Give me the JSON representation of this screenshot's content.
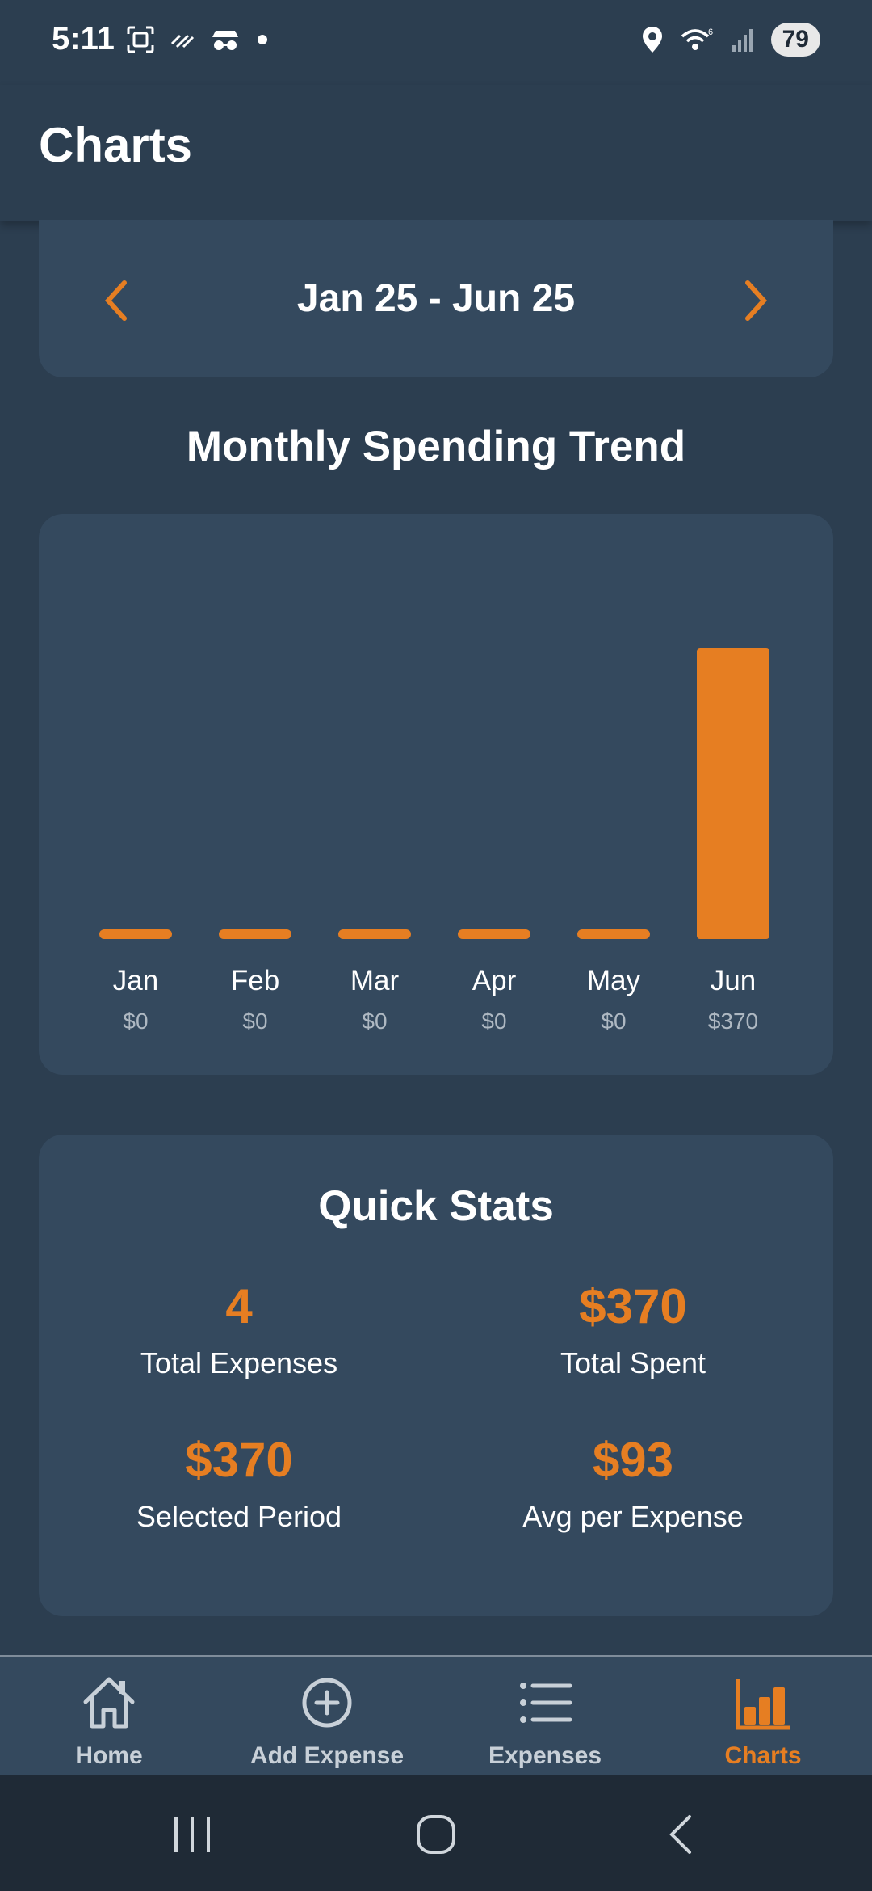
{
  "status_bar": {
    "time": "5:11",
    "battery": "79",
    "icons": [
      "screenshot-icon",
      "nfc-icon",
      "incognito-icon",
      "dot-icon",
      "location-icon",
      "wifi-icon",
      "signal-icon"
    ]
  },
  "header": {
    "title": "Charts"
  },
  "date_range": {
    "label": "Jan 25 - Jun 25",
    "prev_icon": "chevron-left-icon",
    "next_icon": "chevron-right-icon"
  },
  "chart_section": {
    "title": "Monthly Spending Trend"
  },
  "chart_data": {
    "type": "bar",
    "title": "Monthly Spending Trend",
    "categories": [
      "Jan",
      "Feb",
      "Mar",
      "Apr",
      "May",
      "Jun"
    ],
    "values": [
      0,
      0,
      0,
      0,
      0,
      370
    ],
    "value_labels": [
      "$0",
      "$0",
      "$0",
      "$0",
      "$0",
      "$370"
    ],
    "bar_color": "#e67e22"
  },
  "quick_stats": {
    "title": "Quick Stats",
    "items": [
      {
        "value": "4",
        "label": "Total Expenses"
      },
      {
        "value": "$370",
        "label": "Total Spent"
      },
      {
        "value": "$370",
        "label": "Selected Period"
      },
      {
        "value": "$93",
        "label": "Avg per Expense"
      }
    ]
  },
  "bottom_nav": {
    "items": [
      {
        "label": "Home",
        "icon": "home-icon"
      },
      {
        "label": "Add Expense",
        "icon": "add-circle-icon"
      },
      {
        "label": "Expenses",
        "icon": "list-icon"
      },
      {
        "label": "Charts",
        "icon": "bar-chart-icon",
        "active": true
      }
    ]
  },
  "colors": {
    "accent": "#e67e22",
    "background": "#2c3e50",
    "card": "#34495e",
    "system_nav": "#1f2a36"
  }
}
